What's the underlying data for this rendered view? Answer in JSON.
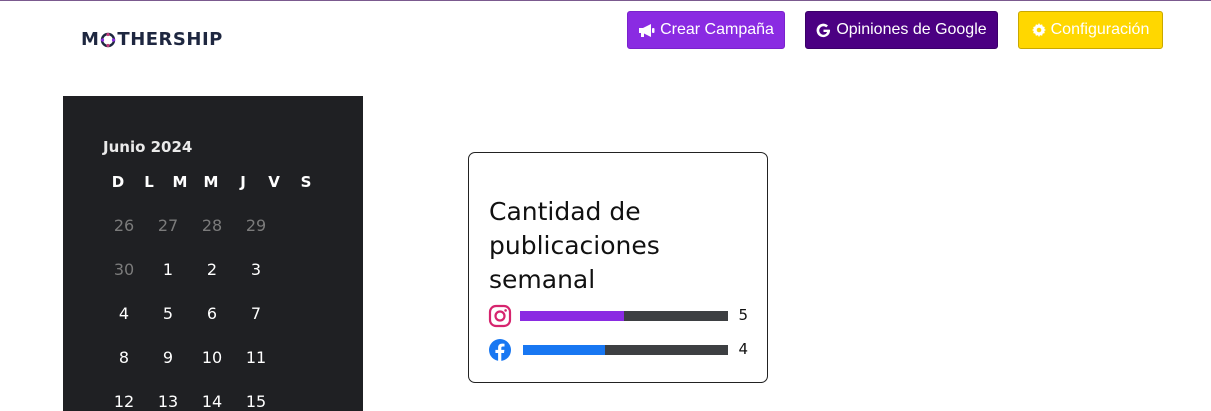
{
  "logo": {
    "text_before": "M",
    "text_after": "THERSHIP"
  },
  "header": {
    "campaign_label": "Crear Campaña",
    "google_label": "Opiniones de Google",
    "config_label": "Configuración"
  },
  "calendar": {
    "month": "Junio 2024",
    "weekdays": [
      "D",
      "L",
      "M",
      "M",
      "J",
      "V",
      "S"
    ],
    "weeks": [
      [
        "26",
        "27",
        "28",
        "29"
      ],
      [
        "30",
        "1",
        "2",
        "3"
      ],
      [
        "4",
        "5",
        "6",
        "7"
      ],
      [
        "8",
        "9",
        "10",
        "11"
      ],
      [
        "12",
        "13",
        "14",
        "15"
      ]
    ]
  },
  "stats": {
    "title": "Cantidad de publicaciones semanal",
    "instagram": {
      "count": "5",
      "fraction": 0.5,
      "color": "#8a2be2"
    },
    "facebook": {
      "count": "4",
      "fraction": 0.4,
      "color": "#1877f2"
    }
  },
  "icons": {
    "campaign": "megaphone-icon",
    "google": "google-g-icon",
    "config": "gear-icon",
    "instagram": "instagram-icon",
    "facebook": "facebook-icon"
  }
}
